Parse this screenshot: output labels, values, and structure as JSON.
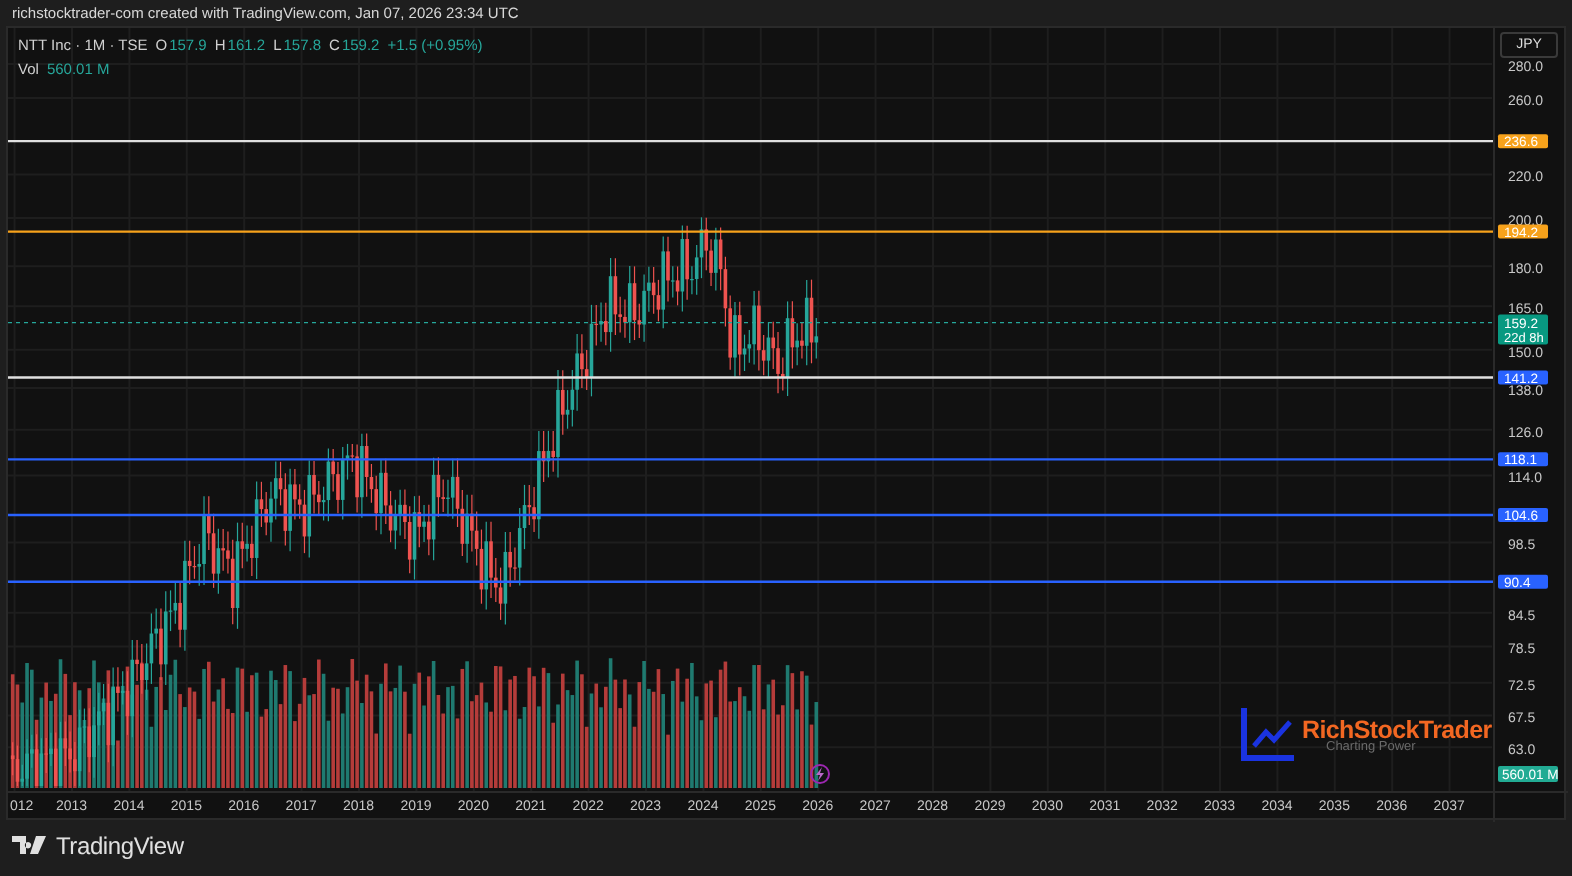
{
  "header": {
    "attribution": "richstocktrader-com created with TradingView.com, Jan 07, 2026 23:34 UTC"
  },
  "legend": {
    "symbol": "NTT Inc · 1M · TSE",
    "ohlc": [
      {
        "key": "O",
        "value": "157.9"
      },
      {
        "key": "H",
        "value": "161.2"
      },
      {
        "key": "L",
        "value": "157.8"
      },
      {
        "key": "C",
        "value": "159.2"
      }
    ],
    "change": "+1.5 (+0.95%)",
    "volume_label": "Vol",
    "volume_value": "560.01 M"
  },
  "currency_button": {
    "label": "JPY"
  },
  "price_axis": {
    "ticks": [
      "280.0",
      "260.0",
      "220.0",
      "200.0",
      "180.0",
      "165.0",
      "150.0",
      "138.0",
      "126.0",
      "114.0",
      "98.5",
      "84.5",
      "78.5",
      "72.5",
      "67.5",
      "63.0"
    ]
  },
  "price_lines": [
    {
      "label": "236.6",
      "color": "#f7a21b",
      "kind": "neutral"
    },
    {
      "label": "194.2",
      "color": "#f7a21b",
      "kind": "matched"
    },
    {
      "label": "141.2",
      "color": "#2962ff",
      "kind": "neutral"
    },
    {
      "label": "118.1",
      "color": "#2962ff",
      "kind": "matched"
    },
    {
      "label": "104.6",
      "color": "#2962ff",
      "kind": "matched"
    },
    {
      "label": "90.4",
      "color": "#2962ff",
      "kind": "matched"
    }
  ],
  "current_price": {
    "label": "159.2",
    "countdown": "22d 8h"
  },
  "volume_badge": {
    "label": "560.01 M"
  },
  "time_axis": {
    "ticks": [
      "012",
      "2013",
      "2014",
      "2015",
      "2016",
      "2017",
      "2018",
      "2019",
      "2020",
      "2021",
      "2022",
      "2023",
      "2024",
      "2025",
      "2026",
      "2027",
      "2028",
      "2029",
      "2030",
      "2031",
      "2032",
      "2033",
      "2034",
      "2035",
      "2036",
      "2037"
    ]
  },
  "chart_logo": {
    "name": "RichStockTrader",
    "tagline": "Charting Power"
  },
  "footer": {
    "brand": "TradingView"
  }
}
